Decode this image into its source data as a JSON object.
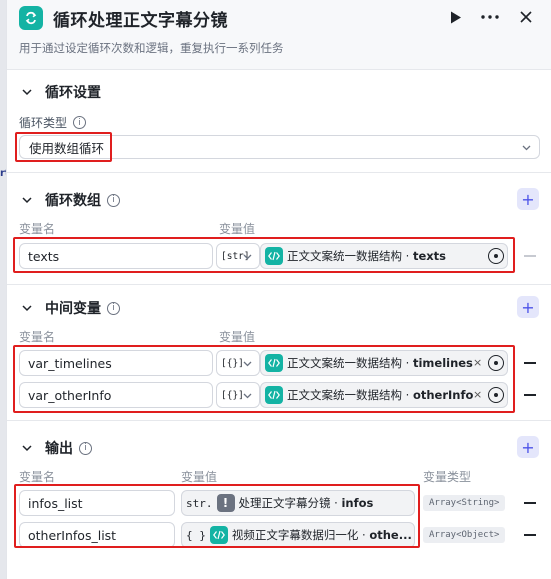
{
  "header": {
    "title": "循环处理正文字幕分镜",
    "subtitle": "用于通过设定循环次数和逻辑，重复执行一系列任务"
  },
  "loop_settings": {
    "section_title": "循环设置",
    "loop_type_label": "循环类型",
    "loop_type_value": "使用数组循环"
  },
  "loop_array": {
    "section_title": "循环数组",
    "col_name": "变量名",
    "col_value": "变量值",
    "rows": [
      {
        "name": "texts",
        "type_tag": "[str]",
        "ref_source": "正文文案统一数据结构",
        "ref_field": "texts"
      }
    ]
  },
  "intermediate_vars": {
    "section_title": "中间变量",
    "col_name": "变量名",
    "col_value": "变量值",
    "rows": [
      {
        "name": "var_timelines",
        "type_tag": "[{}]",
        "ref_source": "正文文案统一数据结构",
        "ref_field": "timelines"
      },
      {
        "name": "var_otherInfo",
        "type_tag": "[{}]",
        "ref_source": "正文文案统一数据结构",
        "ref_field": "otherInfo"
      }
    ]
  },
  "output": {
    "section_title": "输出",
    "col_name": "变量名",
    "col_value": "变量值",
    "col_type": "变量类型",
    "rows": [
      {
        "name": "infos_list",
        "type_tag": "str.",
        "ref_source": "处理正文字幕分镜",
        "ref_field": "infos",
        "var_type": "Array<String>"
      },
      {
        "name": "otherInfos_list",
        "type_tag": "{ }",
        "ref_source": "视频正文字幕数据归一化",
        "ref_field": "othe...",
        "var_type": "Array<Object>"
      }
    ]
  },
  "background": {
    "glyph": "rt"
  },
  "colors": {
    "accent_teal": "#14b3a4",
    "accent_purple": "#4d53e8",
    "highlight_red": "#e01e1e"
  }
}
